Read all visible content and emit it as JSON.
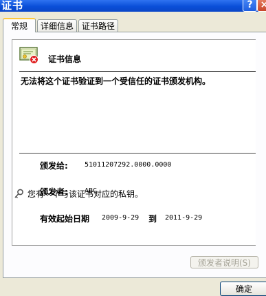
{
  "window": {
    "title": "证书",
    "help_label": "?",
    "close_label": "×"
  },
  "tabs": [
    {
      "label": "常规",
      "active": true
    },
    {
      "label": "详细信息",
      "active": false
    },
    {
      "label": "证书路径",
      "active": false
    }
  ],
  "info": {
    "title": "证书信息",
    "warning": "无法将这个证书验证到一个受信任的证书颁发机构。"
  },
  "fields": {
    "issued_to_label": "颁发给:",
    "issued_to_value": "51011207292.0000.0000",
    "issued_by_label": "颁发者:",
    "issued_by_value": "ABC",
    "valid_from_label": "有效起始日期",
    "valid_from_value": "2009-9-29",
    "valid_to_label": "到",
    "valid_to_value": "2011-9-29"
  },
  "private_key_note": "您有一个与该证书对应的私钥。",
  "buttons": {
    "issuer_statement": "颁发者说明(S)",
    "ok": "确定"
  },
  "icons": {
    "certificate": "certificate-error-icon",
    "key": "key-icon"
  }
}
